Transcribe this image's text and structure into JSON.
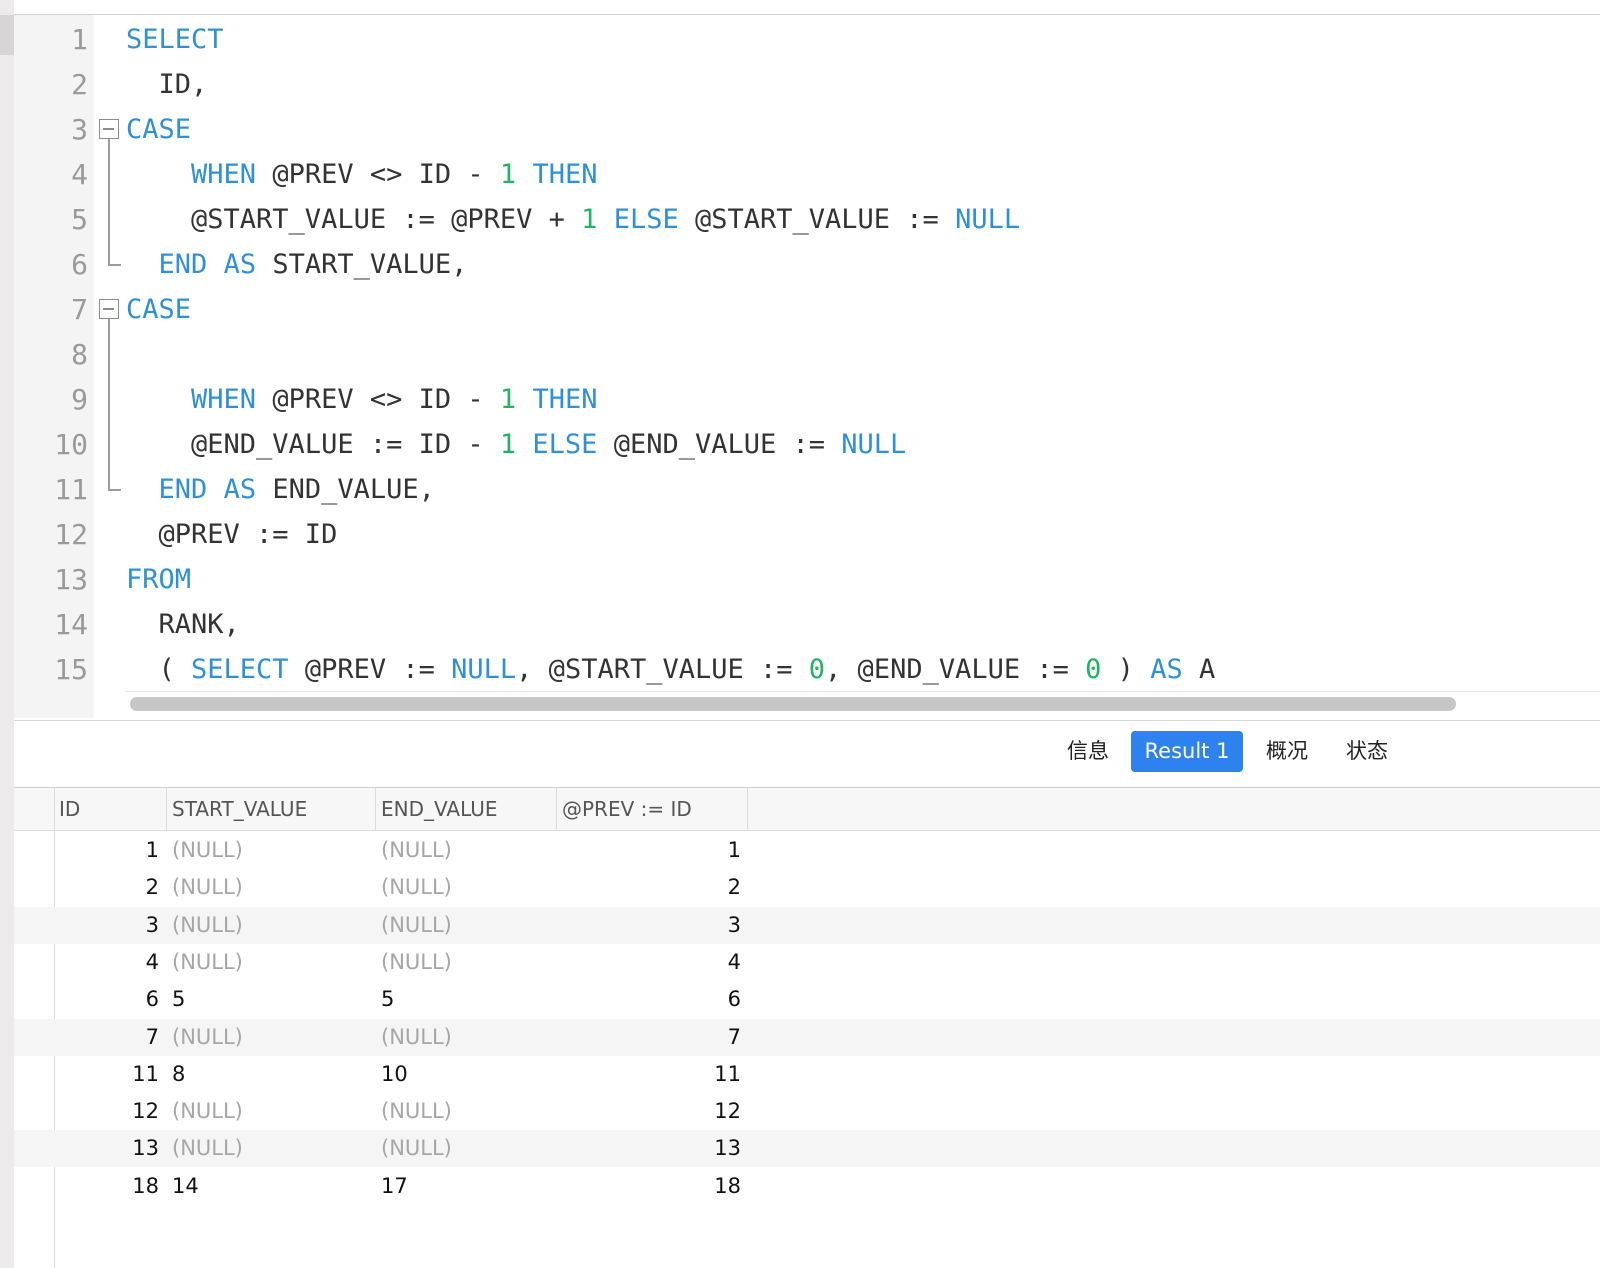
{
  "editor": {
    "lines": [
      {
        "no": "1",
        "tokens": [
          [
            "kw",
            "SELECT"
          ]
        ]
      },
      {
        "no": "2",
        "tokens": [
          [
            "id",
            "  ID,"
          ]
        ]
      },
      {
        "no": "3",
        "fold": "start",
        "tokens": [
          [
            "kw",
            "CASE"
          ]
        ]
      },
      {
        "no": "4",
        "tokens": [
          [
            "id",
            "    "
          ],
          [
            "kw",
            "WHEN"
          ],
          [
            "id",
            " @PREV <> ID - "
          ],
          [
            "num",
            "1"
          ],
          [
            "id",
            " "
          ],
          [
            "kw",
            "THEN"
          ]
        ]
      },
      {
        "no": "5",
        "tokens": [
          [
            "id",
            "    @START_VALUE := @PREV + "
          ],
          [
            "num",
            "1"
          ],
          [
            "id",
            " "
          ],
          [
            "kw",
            "ELSE"
          ],
          [
            "id",
            " @START_VALUE := "
          ],
          [
            "kw",
            "NULL"
          ]
        ]
      },
      {
        "no": "6",
        "fold": "end",
        "tokens": [
          [
            "id",
            "  "
          ],
          [
            "kw",
            "END"
          ],
          [
            "id",
            " "
          ],
          [
            "kw",
            "AS"
          ],
          [
            "id",
            " START_VALUE,"
          ]
        ]
      },
      {
        "no": "7",
        "fold": "start",
        "tokens": [
          [
            "kw",
            "CASE"
          ]
        ]
      },
      {
        "no": "8",
        "tokens": []
      },
      {
        "no": "9",
        "tokens": [
          [
            "id",
            "    "
          ],
          [
            "kw",
            "WHEN"
          ],
          [
            "id",
            " @PREV <> ID - "
          ],
          [
            "num",
            "1"
          ],
          [
            "id",
            " "
          ],
          [
            "kw",
            "THEN"
          ]
        ]
      },
      {
        "no": "10",
        "tokens": [
          [
            "id",
            "    @END_VALUE := ID - "
          ],
          [
            "num",
            "1"
          ],
          [
            "id",
            " "
          ],
          [
            "kw",
            "ELSE"
          ],
          [
            "id",
            " @END_VALUE := "
          ],
          [
            "kw",
            "NULL"
          ]
        ]
      },
      {
        "no": "11",
        "fold": "end",
        "tokens": [
          [
            "id",
            "  "
          ],
          [
            "kw",
            "END"
          ],
          [
            "id",
            " "
          ],
          [
            "kw",
            "AS"
          ],
          [
            "id",
            " END_VALUE,"
          ]
        ]
      },
      {
        "no": "12",
        "tokens": [
          [
            "id",
            "  @PREV := ID"
          ]
        ]
      },
      {
        "no": "13",
        "tokens": [
          [
            "kw",
            "FROM"
          ]
        ]
      },
      {
        "no": "14",
        "tokens": [
          [
            "id",
            "  RANK,"
          ]
        ]
      },
      {
        "no": "15",
        "tokens": [
          [
            "id",
            "  ( "
          ],
          [
            "kw",
            "SELECT"
          ],
          [
            "id",
            " @PREV := "
          ],
          [
            "kw",
            "NULL"
          ],
          [
            "id",
            ", @START_VALUE := "
          ],
          [
            "num",
            "0"
          ],
          [
            "id",
            ", @END_VALUE := "
          ],
          [
            "num",
            "0"
          ],
          [
            "id",
            " ) "
          ],
          [
            "kw",
            "AS"
          ],
          [
            "id",
            " A"
          ]
        ]
      }
    ]
  },
  "tabs": [
    {
      "label": "信息",
      "active": false,
      "name": "tab-info"
    },
    {
      "label": "Result 1",
      "active": true,
      "name": "tab-result-1"
    },
    {
      "label": "概况",
      "active": false,
      "name": "tab-profile"
    },
    {
      "label": "状态",
      "active": false,
      "name": "tab-status"
    }
  ],
  "grid": {
    "columns": [
      "ID",
      "START_VALUE",
      "END_VALUE",
      "@PREV := ID"
    ],
    "rows": [
      [
        "1",
        "(NULL)",
        "(NULL)",
        "1"
      ],
      [
        "2",
        "(NULL)",
        "(NULL)",
        "2"
      ],
      [
        "3",
        "(NULL)",
        "(NULL)",
        "3"
      ],
      [
        "4",
        "(NULL)",
        "(NULL)",
        "4"
      ],
      [
        "6",
        "5",
        "5",
        "6"
      ],
      [
        "7",
        "(NULL)",
        "(NULL)",
        "7"
      ],
      [
        "11",
        "8",
        "10",
        "11"
      ],
      [
        "12",
        "(NULL)",
        "(NULL)",
        "12"
      ],
      [
        "13",
        "(NULL)",
        "(NULL)",
        "13"
      ],
      [
        "18",
        "14",
        "17",
        "18"
      ]
    ],
    "alt_rows": [
      2,
      5,
      8
    ]
  },
  "colors": {
    "keyword": "#2f8fd8",
    "number": "#22b464",
    "identifier": "#333333",
    "active_tab": "#2d82f0",
    "null_text": "#a6a6a6"
  }
}
